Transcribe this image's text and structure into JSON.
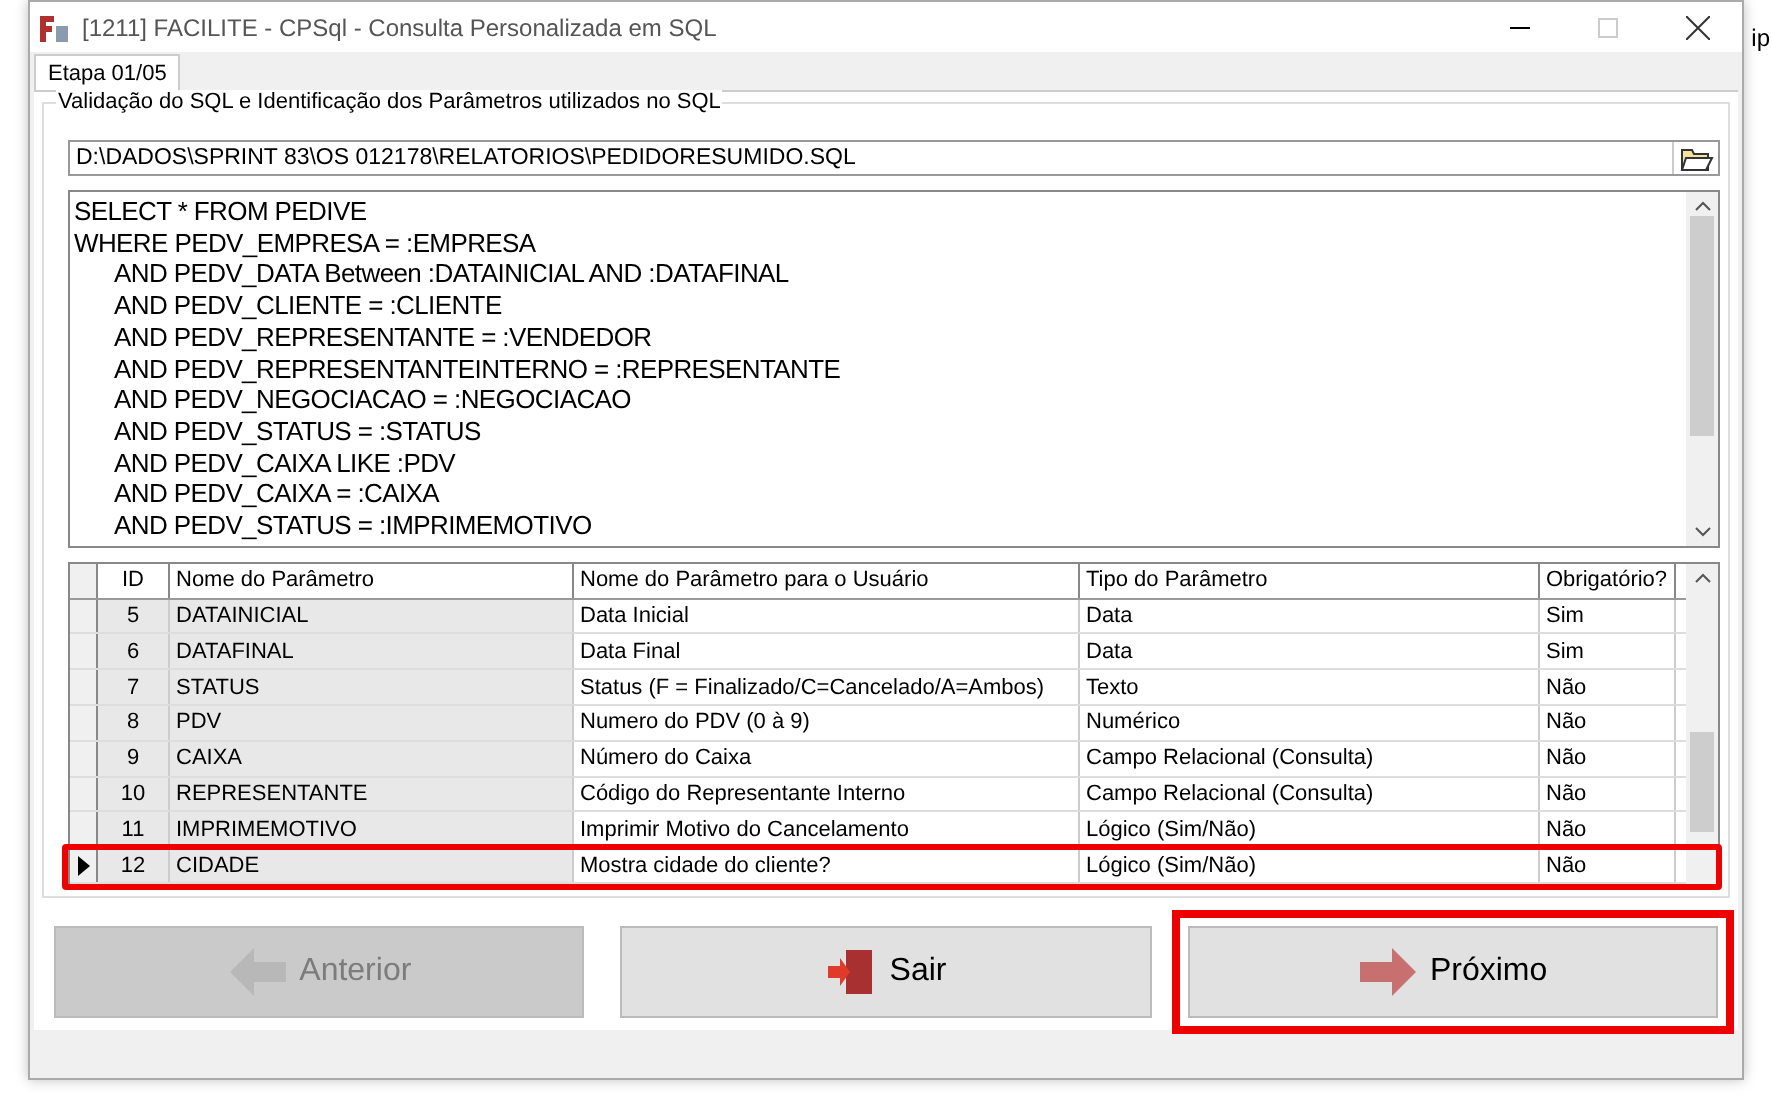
{
  "desktop": {
    "edge_text": "ip"
  },
  "window": {
    "title": "[1211] FACILITE - CPSql - Consulta Personalizada em SQL"
  },
  "tabs": [
    {
      "label": "Etapa 01/05",
      "selected": true
    }
  ],
  "group": {
    "title": "Validação do SQL e Identificação dos Parâmetros utilizados no SQL"
  },
  "file_path": "D:\\DADOS\\SPRINT 83\\OS 012178\\RELATORIOS\\PEDIDORESUMIDO.SQL",
  "sql_lines": [
    {
      "text": "SELECT * FROM PEDIVE",
      "indent": false
    },
    {
      "text": "WHERE PEDV_EMPRESA = :EMPRESA",
      "indent": false
    },
    {
      "text": "AND PEDV_DATA Between :DATAINICIAL AND :DATAFINAL",
      "indent": true
    },
    {
      "text": "AND PEDV_CLIENTE = :CLIENTE",
      "indent": true
    },
    {
      "text": "AND PEDV_REPRESENTANTE = :VENDEDOR",
      "indent": true
    },
    {
      "text": "AND PEDV_REPRESENTANTEINTERNO = :REPRESENTANTE",
      "indent": true
    },
    {
      "text": "AND PEDV_NEGOCIACAO = :NEGOCIACAO",
      "indent": true
    },
    {
      "text": "AND PEDV_STATUS = :STATUS",
      "indent": true
    },
    {
      "text": "AND PEDV_CAIXA LIKE :PDV",
      "indent": true
    },
    {
      "text": "AND PEDV_CAIXA = :CAIXA",
      "indent": true
    },
    {
      "text": "AND PEDV_STATUS = :IMPRIMEMOTIVO",
      "indent": true
    }
  ],
  "table": {
    "columns": [
      "ID",
      "Nome do Parâmetro",
      "Nome do Parâmetro para o Usuário",
      "Tipo do Parâmetro",
      "Obrigatório?"
    ],
    "rows": [
      {
        "cells": [
          "5",
          "DATAINICIAL",
          "Data Inicial",
          "Data",
          "Sim"
        ],
        "selected": false,
        "highlighted": false
      },
      {
        "cells": [
          "6",
          "DATAFINAL",
          "Data Final",
          "Data",
          "Sim"
        ],
        "selected": false,
        "highlighted": false
      },
      {
        "cells": [
          "7",
          "STATUS",
          "Status (F = Finalizado/C=Cancelado/A=Ambos)",
          "Texto",
          "Não"
        ],
        "selected": false,
        "highlighted": false
      },
      {
        "cells": [
          "8",
          "PDV",
          "Numero do PDV (0 à 9)",
          "Numérico",
          "Não"
        ],
        "selected": false,
        "highlighted": false
      },
      {
        "cells": [
          "9",
          "CAIXA",
          "Número do Caixa",
          "Campo Relacional (Consulta)",
          "Não"
        ],
        "selected": false,
        "highlighted": false
      },
      {
        "cells": [
          "10",
          "REPRESENTANTE",
          "Código do Representante Interno",
          "Campo Relacional (Consulta)",
          "Não"
        ],
        "selected": false,
        "highlighted": false
      },
      {
        "cells": [
          "11",
          "IMPRIMEMOTIVO",
          "Imprimir Motivo do Cancelamento",
          "Lógico (Sim/Não)",
          "Não"
        ],
        "selected": false,
        "highlighted": false
      },
      {
        "cells": [
          "12",
          "CIDADE",
          "Mostra cidade do cliente?",
          "Lógico (Sim/Não)",
          "Não"
        ],
        "selected": true,
        "highlighted": true
      }
    ]
  },
  "buttons": [
    {
      "label": "Anterior",
      "kind": "back",
      "disabled": true,
      "highlighted": false
    },
    {
      "label": "Sair",
      "kind": "exit",
      "disabled": false,
      "highlighted": false
    },
    {
      "label": "Próximo",
      "kind": "next",
      "disabled": false,
      "highlighted": true
    }
  ]
}
